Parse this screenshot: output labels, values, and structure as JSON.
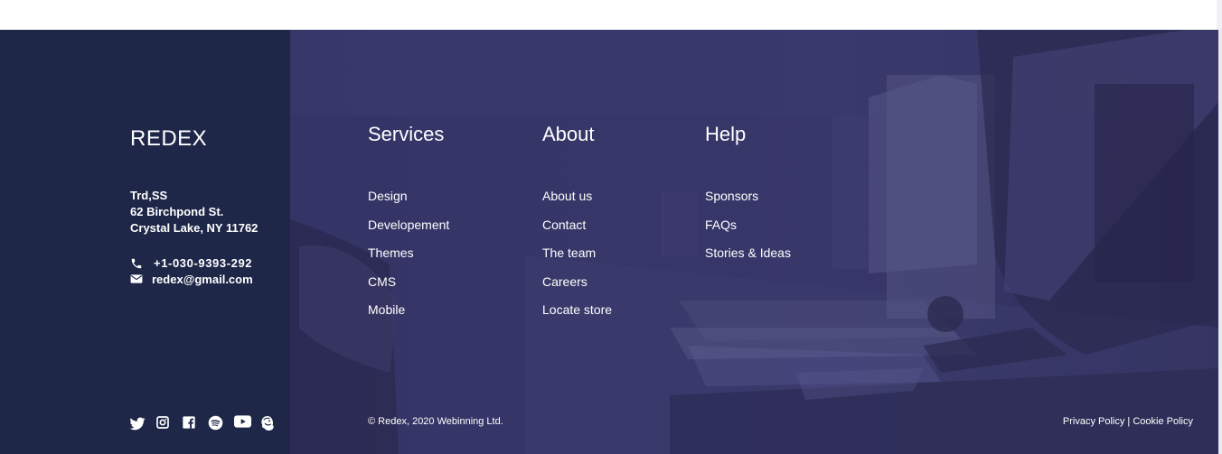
{
  "brand": {
    "name": "REDEX"
  },
  "address": {
    "line1": "Trd,SS",
    "line2": "62 Birchpond St.",
    "line3": "Crystal Lake, NY 11762"
  },
  "contact": {
    "phone": "+1-030-9393-292",
    "email": "redex@gmail.com"
  },
  "socials": [
    "twitter-icon",
    "instagram-icon",
    "facebook-icon",
    "spotify-icon",
    "youtube-icon",
    "mailchimp-icon"
  ],
  "columns": {
    "services": {
      "title": "Services",
      "items": [
        "Design",
        "Developement",
        "Themes",
        "CMS",
        "Mobile"
      ]
    },
    "about": {
      "title": "About",
      "items": [
        "About us",
        "Contact",
        "The team",
        "Careers",
        "Locate store"
      ]
    },
    "help": {
      "title": "Help",
      "items": [
        "Sponsors",
        "FAQs",
        "Stories & Ideas"
      ]
    }
  },
  "footer": {
    "copyright": "© Redex, 2020 Webinning Ltd.",
    "privacy": "Privacy Policy",
    "separator": " | ",
    "cookie": "Cookie Policy"
  },
  "colors": {
    "left_panel": "#1f2749",
    "overlay": "#33325f",
    "text": "#ffffff"
  }
}
